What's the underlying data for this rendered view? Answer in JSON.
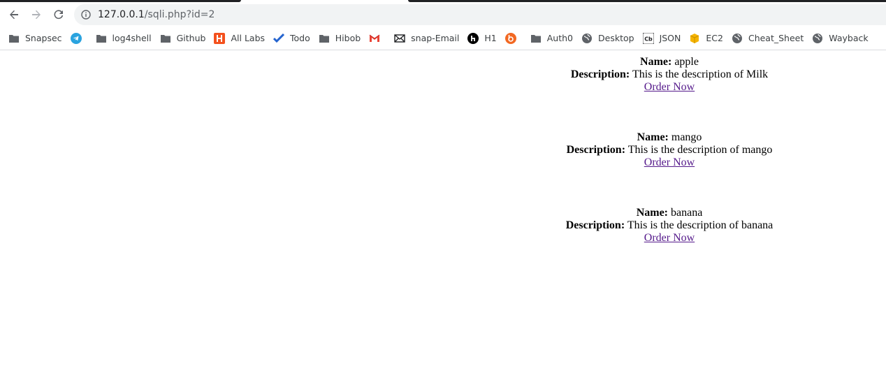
{
  "browser": {
    "url_host": "127.0.0.1",
    "url_path": "/sqli.php?id=2",
    "bookmarks": [
      {
        "label": "Snapsec",
        "icon": "folder-icon"
      },
      {
        "label": "",
        "icon": "telegram-icon"
      },
      {
        "label": "log4shell",
        "icon": "folder-icon"
      },
      {
        "label": "Github",
        "icon": "folder-icon"
      },
      {
        "label": "All Labs",
        "icon": "labs-icon"
      },
      {
        "label": "Todo",
        "icon": "todo-check-icon"
      },
      {
        "label": "Hibob",
        "icon": "folder-icon"
      },
      {
        "label": "",
        "icon": "gmail-icon"
      },
      {
        "label": "snap-Email",
        "icon": "envelope-icon"
      },
      {
        "label": "H1",
        "icon": "hackerone-icon"
      },
      {
        "label": "",
        "icon": "bugcrowd-icon"
      },
      {
        "label": "Auth0",
        "icon": "folder-icon"
      },
      {
        "label": "Desktop",
        "icon": "globe-icon"
      },
      {
        "label": "JSON",
        "icon": "cb-icon"
      },
      {
        "label": "EC2",
        "icon": "aws-cube-icon"
      },
      {
        "label": "Cheat_Sheet",
        "icon": "globe-icon"
      },
      {
        "label": "Wayback",
        "icon": "globe-icon"
      }
    ]
  },
  "products": [
    {
      "name_label": "Name:",
      "name": "apple",
      "description_label": "Description:",
      "description": "This is the description of Milk",
      "order_link": "Order Now"
    },
    {
      "name_label": "Name:",
      "name": "mango",
      "description_label": "Description:",
      "description": "This is the description of mango",
      "order_link": "Order Now"
    },
    {
      "name_label": "Name:",
      "name": "banana",
      "description_label": "Description:",
      "description": "This is the description of banana",
      "order_link": "Order Now"
    }
  ]
}
